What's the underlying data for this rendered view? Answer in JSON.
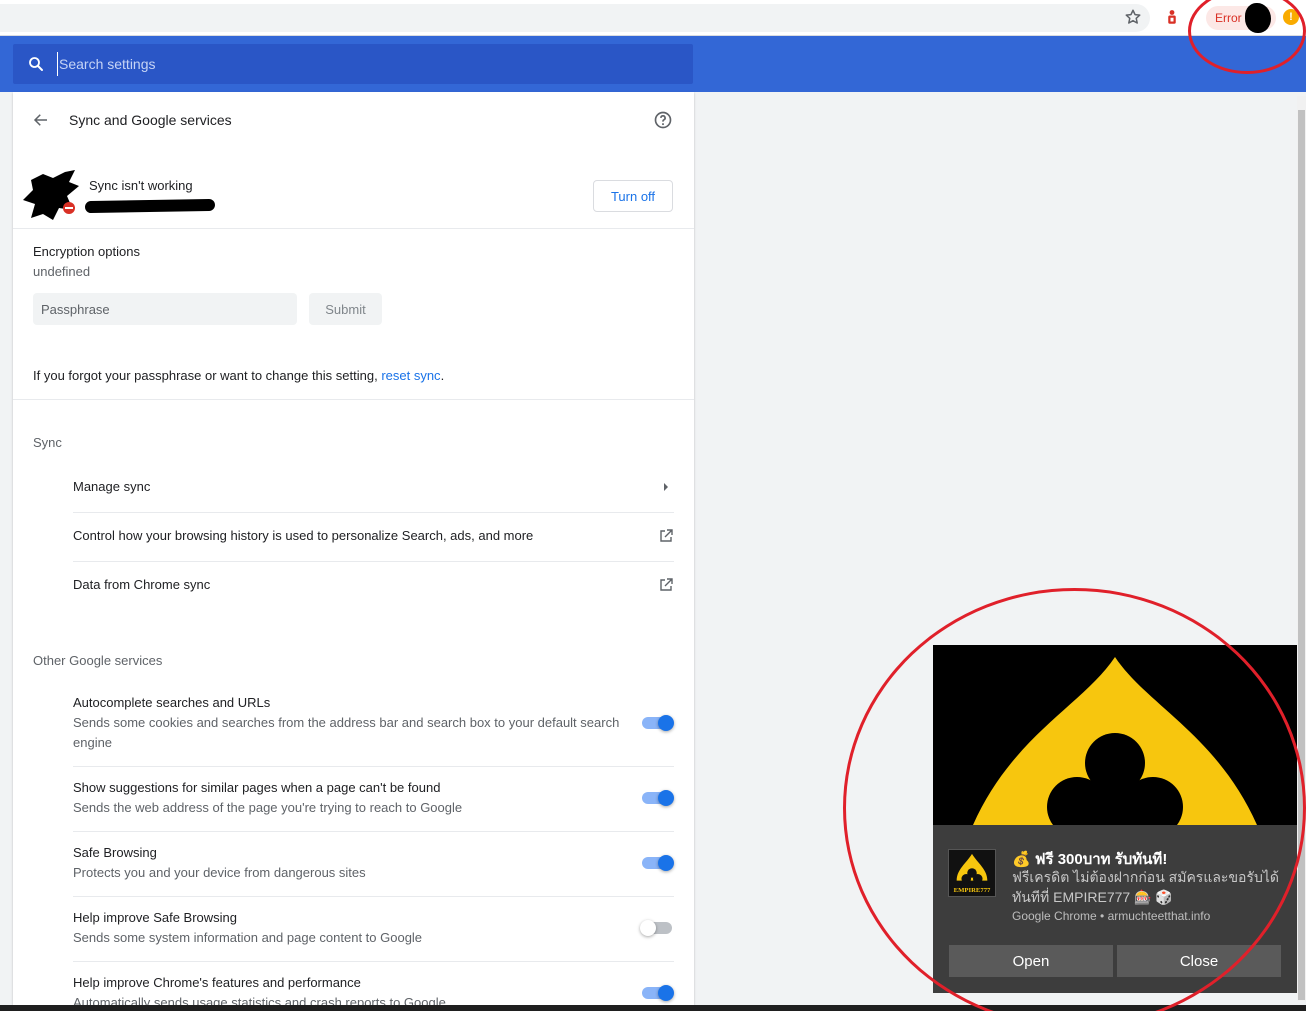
{
  "browser": {
    "error_label": "Error",
    "warning_glyph": "!",
    "icons": [
      "star-icon",
      "extension-icon",
      "profile-avatar",
      "warning-icon"
    ]
  },
  "search": {
    "placeholder": "Search settings"
  },
  "page": {
    "title": "Sync and Google services",
    "account": {
      "status": "Sync isn't working",
      "turn_off_label": "Turn off"
    },
    "encryption": {
      "title": "Encryption options",
      "subtitle": "undefined",
      "passphrase_placeholder": "Passphrase",
      "submit_label": "Submit"
    },
    "forgot": {
      "text": "If you forgot your passphrase or want to change this setting, ",
      "link": "reset sync",
      "end": "."
    },
    "sync_section": {
      "title": "Sync",
      "items": [
        {
          "label": "Manage sync",
          "icon": "arrow-right-icon"
        },
        {
          "label": "Control how your browsing history is used to personalize Search, ads, and more",
          "icon": "external-link-icon"
        },
        {
          "label": "Data from Chrome sync",
          "icon": "external-link-icon"
        }
      ]
    },
    "other_section": {
      "title": "Other Google services",
      "items": [
        {
          "title": "Autocomplete searches and URLs",
          "desc": "Sends some cookies and searches from the address bar and search box to your default search engine",
          "on": true
        },
        {
          "title": "Show suggestions for similar pages when a page can't be found",
          "desc": "Sends the web address of the page you're trying to reach to Google",
          "on": true
        },
        {
          "title": "Safe Browsing",
          "desc": "Protects you and your device from dangerous sites",
          "on": true
        },
        {
          "title": "Help improve Safe Browsing",
          "desc": "Sends some system information and page content to Google",
          "on": false
        },
        {
          "title": "Help improve Chrome's features and performance",
          "desc": "Automatically sends usage statistics and crash reports to Google",
          "on": true
        }
      ]
    }
  },
  "notification": {
    "title": "💰 ฟรี 300บาท รับทันที!",
    "text": "ฟรีเครดิต ไม่ต้องฝากก่อน สมัครและขอรับได้ทันทีที่ EMPIRE777 🎰 🎲",
    "source": "Google Chrome • armuchteetthat.info",
    "logo_text": "EMPIRE777",
    "open_label": "Open",
    "close_label": "Close"
  },
  "colors": {
    "header_blue": "#3367d6",
    "accent": "#1a73e8",
    "annotation_red": "#e0202a",
    "notif_gold": "#f7c60e"
  }
}
